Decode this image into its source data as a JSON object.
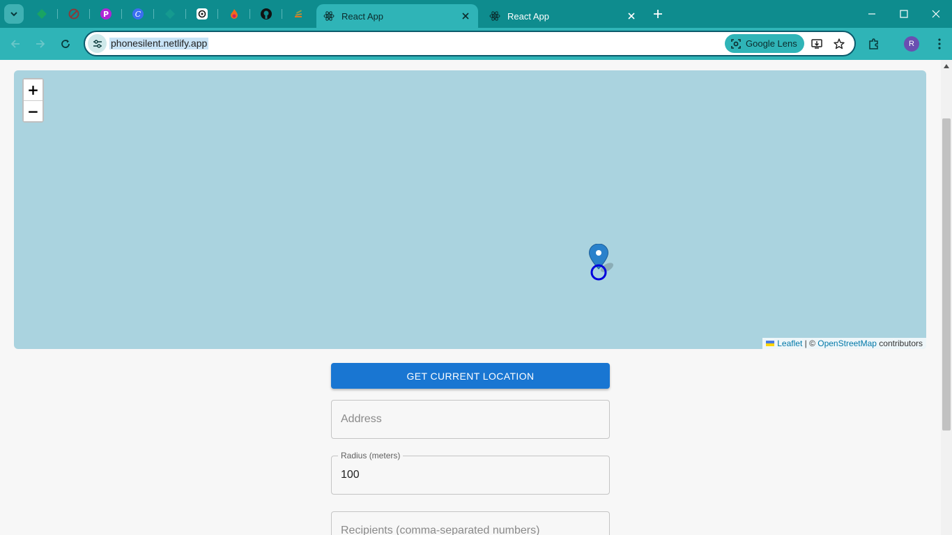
{
  "browser": {
    "pinned_tabs": [
      "grid-app",
      "adblock",
      "picsart",
      "canva",
      "diamond-app",
      "chatgpt",
      "firefox-app",
      "github",
      "stack-app"
    ],
    "tabs": [
      {
        "title": "React App",
        "active": true
      },
      {
        "title": "React App",
        "active": false
      }
    ],
    "url": "phonesilent.netlify.app",
    "lens_label": "Google Lens",
    "profile_initial": "R",
    "colors": {
      "tabbar": "#0e8c8e",
      "toolbar": "#2fb4b7"
    }
  },
  "map": {
    "zoom_in": "+",
    "zoom_out": "−",
    "attribution": {
      "leaflet": "Leaflet",
      "separator": " | © ",
      "osm": "OpenStreetMap",
      "suffix": " contributors"
    },
    "water_color": "#aad3df"
  },
  "form": {
    "get_location_label": "GET CURRENT LOCATION",
    "address_placeholder": "Address",
    "radius_label": "Radius (meters)",
    "radius_value": "100",
    "recipients_placeholder": "Recipients (comma-separated numbers)"
  }
}
